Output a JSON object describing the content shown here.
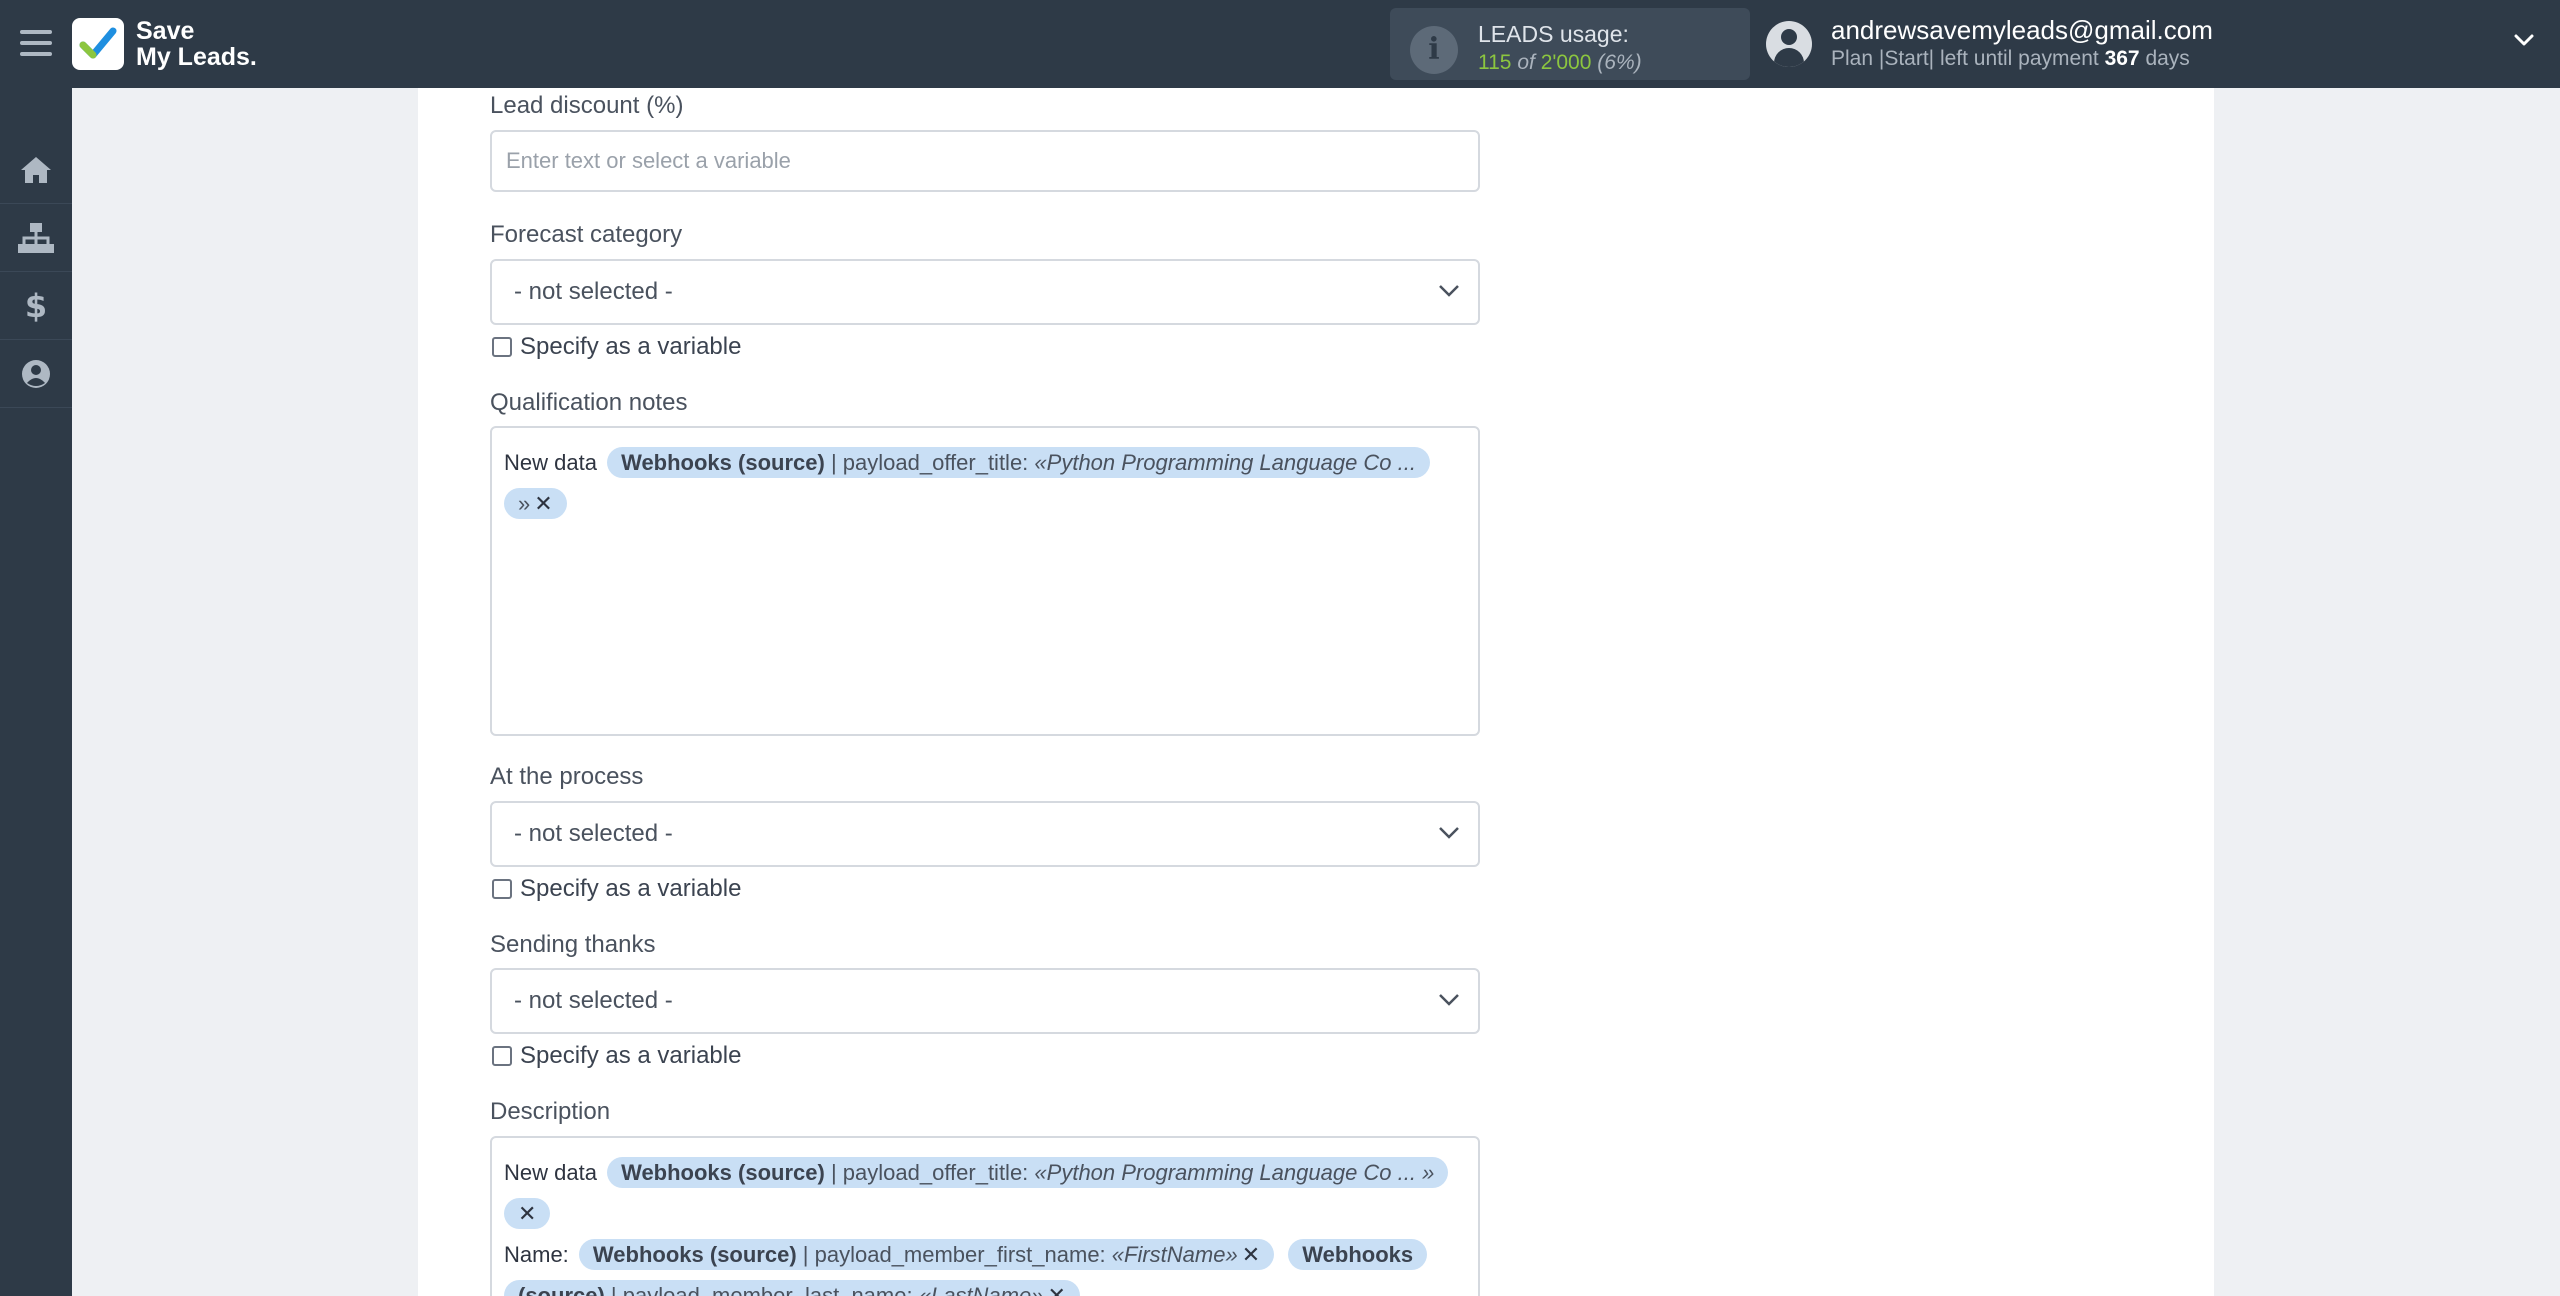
{
  "header": {
    "logo_line1": "Save",
    "logo_line2": "My Leads.",
    "usage_title": "LEADS usage:",
    "usage_used": "115",
    "usage_of": "of",
    "usage_total": "2'000",
    "usage_percent": "(6%)",
    "email": "andrewsavemyleads@gmail.com",
    "plan_text": "Plan |Start| left until payment",
    "plan_days": "367",
    "plan_days_unit": "days"
  },
  "sidebar": {
    "items": [
      {
        "name": "home-icon"
      },
      {
        "name": "sitemap-icon"
      },
      {
        "name": "dollar-icon"
      },
      {
        "name": "user-circle-icon"
      }
    ]
  },
  "form": {
    "lead_discount": {
      "label": "Lead discount (%)",
      "placeholder": "Enter text or select a variable"
    },
    "forecast_category": {
      "label": "Forecast category",
      "value": "- not selected -",
      "checkbox": "Specify as a variable"
    },
    "qualification_notes": {
      "label": "Qualification notes",
      "prefix": "New data",
      "tag_source": "Webhooks (source)",
      "tag_field": "| payload_offer_title:",
      "tag_value": "«Python Programming Language Co ...",
      "tag_value_end": "»"
    },
    "at_the_process": {
      "label": "At the process",
      "value": "- not selected -",
      "checkbox": "Specify as a variable"
    },
    "sending_thanks": {
      "label": "Sending thanks",
      "value": "- not selected -",
      "checkbox": "Specify as a variable"
    },
    "description": {
      "label": "Description",
      "prefix": "New data",
      "tag1_source": "Webhooks (source)",
      "tag1_field": "| payload_offer_title:",
      "tag1_value": "«Python Programming Language Co ... »",
      "name_prefix": "Name:",
      "tag2_source": "Webhooks (source)",
      "tag2_field": "| payload_member_first_name:",
      "tag2_value": "«FirstName»",
      "tag3_source_a": "Webhooks",
      "tag3_source_b": "(source)",
      "tag3_field": "| payload_member_last_name:",
      "tag3_value": "«LastName»"
    }
  },
  "colors": {
    "header_bg": "#2e3a47",
    "accent_green": "#8cc63f",
    "tag_bg": "#c9dff5"
  }
}
